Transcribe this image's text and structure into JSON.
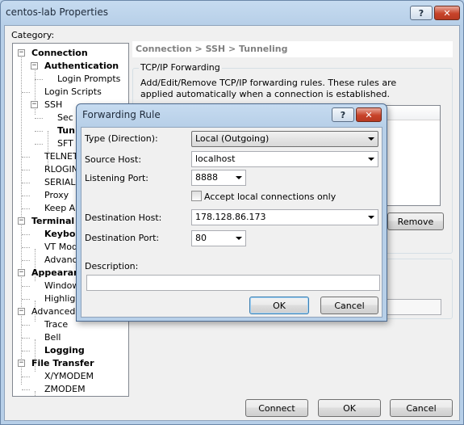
{
  "main": {
    "title": "centos-lab Properties",
    "help_btn": "?",
    "close_btn": "✕",
    "category_label": "Category:",
    "breadcrumb": "Connection > SSH > Tunneling",
    "tree": [
      {
        "label": "Connection",
        "bold": true,
        "expander": "−"
      },
      {
        "label": "Authentication",
        "bold": true,
        "expander": "−"
      },
      {
        "label": "Login Prompts",
        "bold": false
      },
      {
        "label": "Login Scripts",
        "bold": false
      },
      {
        "label": "SSH",
        "bold": false,
        "expander": "−"
      },
      {
        "label": "Sec",
        "bold": false
      },
      {
        "label": "Tun",
        "bold": true
      },
      {
        "label": "SFT",
        "bold": false
      },
      {
        "label": "TELNET",
        "bold": false
      },
      {
        "label": "RLOGIN",
        "bold": false
      },
      {
        "label": "SERIAL",
        "bold": false
      },
      {
        "label": "Proxy",
        "bold": false
      },
      {
        "label": "Keep Al",
        "bold": false
      },
      {
        "label": "Terminal",
        "bold": true,
        "expander": "−"
      },
      {
        "label": "Keybo",
        "bold": true
      },
      {
        "label": "VT Mode",
        "bold": false
      },
      {
        "label": "Advanc",
        "bold": false
      },
      {
        "label": "Appearan",
        "bold": true,
        "expander": "−"
      },
      {
        "label": "Window",
        "bold": false
      },
      {
        "label": "Highligh",
        "bold": false
      },
      {
        "label": "Advanced",
        "bold": false,
        "expander": "−"
      },
      {
        "label": "Trace",
        "bold": false
      },
      {
        "label": "Bell",
        "bold": false
      },
      {
        "label": "Logging",
        "bold": true
      },
      {
        "label": "File Transfer",
        "bold": true,
        "expander": "−"
      },
      {
        "label": "X/YMODEM",
        "bold": false
      },
      {
        "label": "ZMODEM",
        "bold": false
      }
    ],
    "tcp_group_title": "TCP/IP Forwarding",
    "tcp_desc": "Add/Edit/Remove TCP/IP forwarding rules. These rules are applied automatically when a connection is established.",
    "remove_btn": "Remove",
    "connect_btn": "Connect",
    "ok_btn": "OK",
    "cancel_btn": "Cancel"
  },
  "dialog": {
    "title": "Forwarding Rule",
    "help_btn": "?",
    "close_btn": "✕",
    "type_label": "Type (Direction):",
    "type_value": "Local (Outgoing)",
    "source_host_label": "Source Host:",
    "source_host_value": "localhost",
    "listening_port_label": "Listening Port:",
    "listening_port_value": "8888",
    "accept_local_label": "Accept local connections only",
    "accept_local_checked": false,
    "dest_host_label": "Destination Host:",
    "dest_host_value": "178.128.86.173",
    "dest_port_label": "Destination Port:",
    "dest_port_value": "80",
    "description_label": "Description:",
    "description_value": "",
    "ok_btn": "OK",
    "cancel_btn": "Cancel"
  }
}
